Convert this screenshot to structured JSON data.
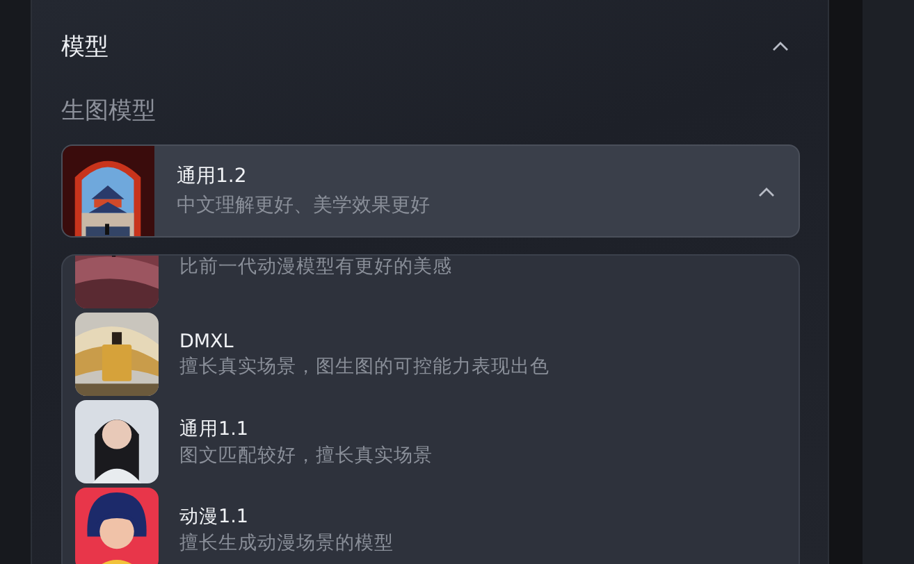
{
  "section": {
    "title": "模型",
    "expanded": true
  },
  "field": {
    "label": "生图模型",
    "expanded": true,
    "value": {
      "title": "通用1.2",
      "description": "中文理解更好、美学效果更好"
    }
  },
  "options": [
    {
      "description": "比前一代动漫模型有更好的美感"
    },
    {
      "title": "DMXL",
      "description": "擅长真实场景，图生图的可控能力表现出色"
    },
    {
      "title": "通用1.1",
      "description": "图文匹配较好，擅长真实场景"
    },
    {
      "title": "动漫1.1",
      "description": "擅长生成动漫场景的模型"
    }
  ]
}
